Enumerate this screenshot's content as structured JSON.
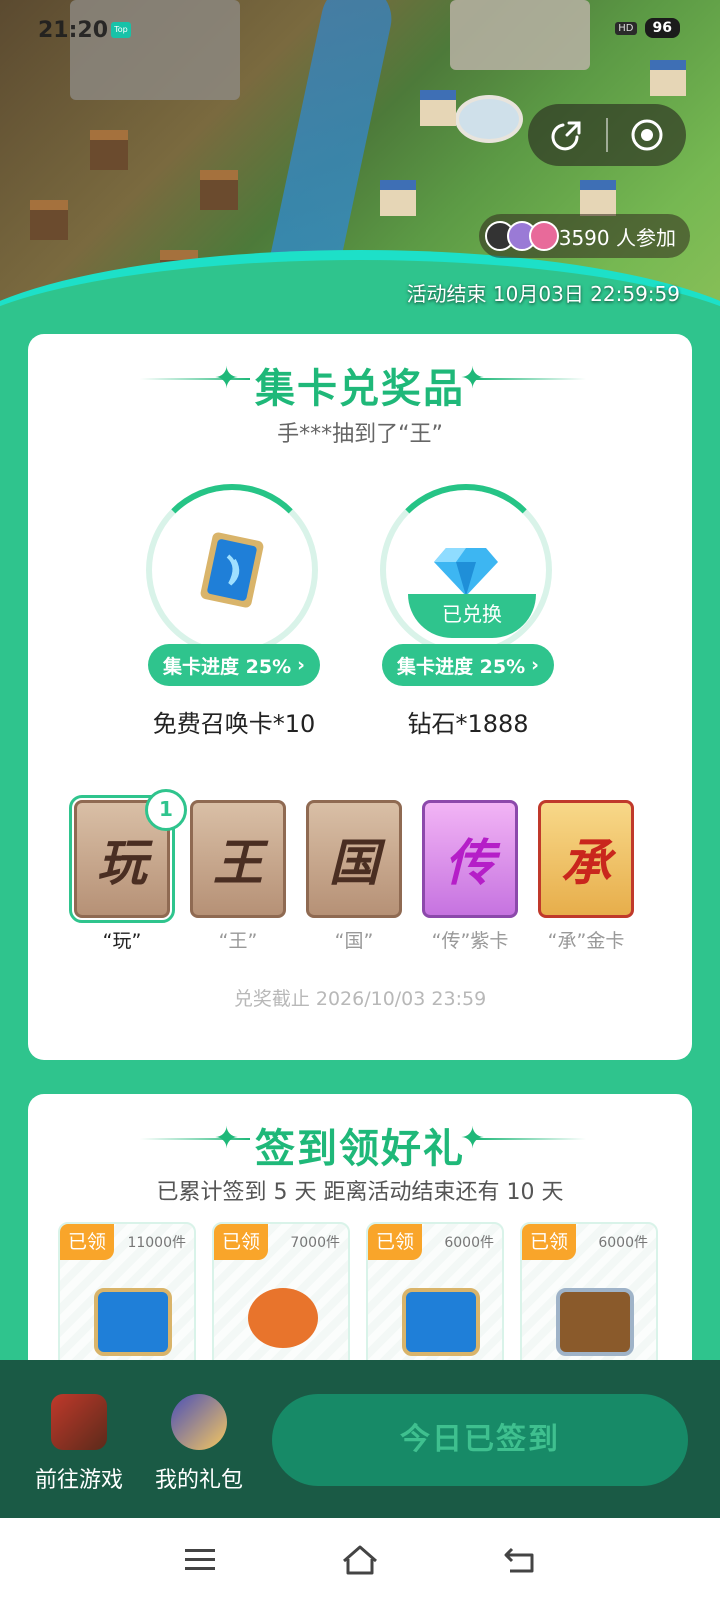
{
  "status_bar": {
    "time": "21:20",
    "top_badge": "Top",
    "hd": "HD",
    "battery": "96"
  },
  "header": {
    "participants_count": "3590 人参加",
    "end_time": "活动结束 10月03日 22:59:59",
    "share_icon": "share-icon",
    "record_icon": "target-icon"
  },
  "collect": {
    "title": "集卡兑奖品",
    "ticker": "手***抽到了“王”",
    "prizes": [
      {
        "name": "免费召唤卡*10",
        "progress_label": "集卡进度 25%",
        "claimed": "",
        "progress": 0.25
      },
      {
        "name": "钻石*1888",
        "progress_label": "集卡进度 25%",
        "claimed": "已兑换",
        "progress": 0.25
      }
    ],
    "word_cards": [
      {
        "char": "玩",
        "label": "“玩”",
        "count": "1"
      },
      {
        "char": "王",
        "label": "“王”"
      },
      {
        "char": "国",
        "label": "“国”"
      },
      {
        "char": "传",
        "label": "“传”紫卡"
      },
      {
        "char": "承",
        "label": "“承”金卡"
      }
    ],
    "deadline": "兑奖截止 2026/10/03 23:59"
  },
  "signin": {
    "title": "签到领好礼",
    "summary": "已累计签到 5 天  距离活动结束还有 10 天",
    "days": [
      {
        "status": "已领",
        "qty": "11000件"
      },
      {
        "status": "已领",
        "qty": "7000件"
      },
      {
        "status": "已领",
        "qty": "6000件"
      },
      {
        "status": "已领",
        "qty": "6000件"
      }
    ]
  },
  "bottom": {
    "goto_game": "前往游戏",
    "my_gifts": "我的礼包",
    "signed_today": "今日已签到"
  },
  "colors": {
    "primary": "#2fc48d",
    "dark_bar": "#1a5a45",
    "claimed_tag": "#f9a52a"
  }
}
